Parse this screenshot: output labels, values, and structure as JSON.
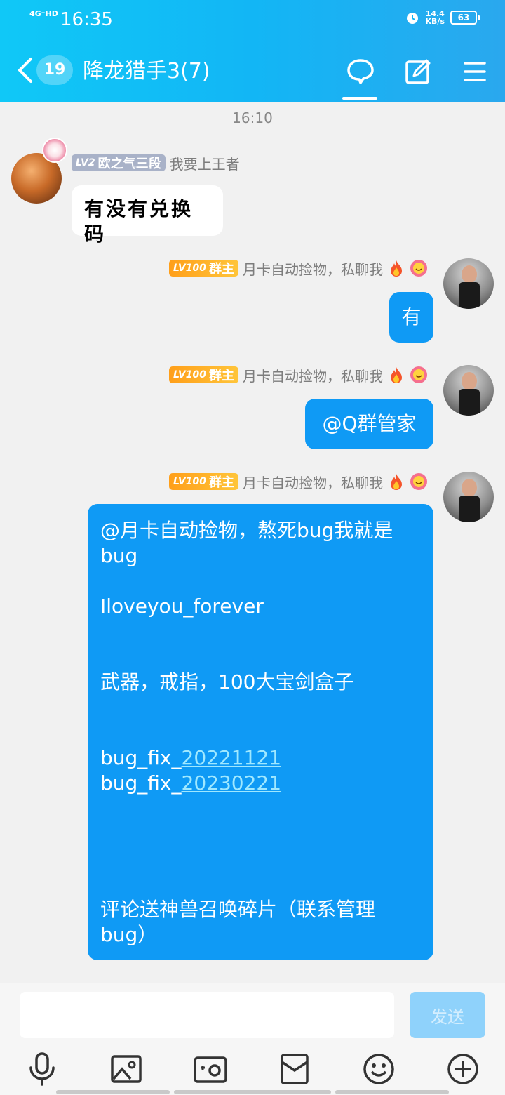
{
  "status_bar": {
    "network": "4G⁺HD",
    "time": "16:35",
    "speed_value": "14.4",
    "speed_unit": "KB/s",
    "battery": "63"
  },
  "nav": {
    "badge_count": "19",
    "title": "降龙猎手3(7)"
  },
  "chat": {
    "timestamp": "16:10",
    "messages": [
      {
        "level": "LV2",
        "role": "欧之气三段",
        "nickname": "我要上王者",
        "text": "有没有兑换码"
      },
      {
        "level": "LV100",
        "role": "群主",
        "nickname": "月卡自动捡物，私聊我",
        "text": "有"
      },
      {
        "level": "LV100",
        "role": "群主",
        "nickname": "月卡自动捡物，私聊我",
        "text": "@Q群管家"
      },
      {
        "level": "LV100",
        "role": "群主",
        "nickname": "月卡自动捡物，私聊我",
        "text_lines": {
          "l1": "@月卡自动捡物，熬死bug我就是",
          "l2": "bug",
          "l3": "Iloveyou_forever",
          "l4": "武器，戒指，100大宝剑盒子",
          "l5a": "bug_fix_",
          "l5b": "20221121",
          "l6a": "bug_fix_",
          "l6b": "20230221",
          "l7": "评论送神兽召唤碎片（联系管理",
          "l8": "bug）"
        }
      }
    ]
  },
  "input": {
    "value": "",
    "send_label": "发送"
  },
  "icons": [
    "back-icon",
    "chat-icon",
    "edit-icon",
    "menu-icon",
    "mic-icon",
    "image-icon",
    "camera-icon",
    "red-packet-icon",
    "emoji-icon",
    "plus-icon"
  ],
  "colors": {
    "header": "#12b6f5",
    "bubble_right": "#0f9af5",
    "link": "#9fe8ff"
  }
}
